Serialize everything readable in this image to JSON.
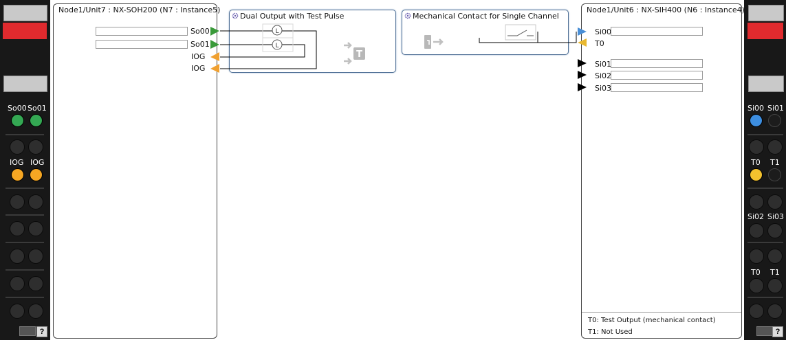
{
  "left_terminal": {
    "labels": [
      "So00",
      "So01",
      "IOG",
      "IOG"
    ],
    "led_colors": [
      "#34a853",
      "#34a853",
      "#f5a623",
      "#f5a623"
    ],
    "help": "?"
  },
  "right_terminal": {
    "labels": [
      "Si00",
      "Si01",
      "T0",
      "T1",
      "Si02",
      "Si03",
      "T0",
      "T1"
    ],
    "led_colors": [
      "#3d8ee0",
      "#1c1c1c",
      "#f2c12e",
      "#1c1c1c"
    ],
    "help": "?"
  },
  "output_unit": {
    "title": "Node1/Unit7 : NX-SOH200 (N7 : Instance5)",
    "pins": [
      "So00",
      "So01",
      "IOG",
      "IOG"
    ]
  },
  "input_unit": {
    "title": "Node1/Unit6 : NX-SIH400 (N6 : Instance4)",
    "pins": [
      "Si00",
      "T0",
      "Si01",
      "Si02",
      "Si03"
    ],
    "notes": [
      "T0: Test Output (mechanical contact)",
      "T1: Not Used"
    ]
  },
  "fb_dual_output": {
    "title": "Dual Output with Test Pulse"
  },
  "fb_mechanical_contact": {
    "title": "Mechanical Contact for Single Channel"
  },
  "colors": {
    "output_arrow": "#3a9a3a",
    "iog_arrow": "#f0a030",
    "si_arrow": "#4a8fd6",
    "t0_arrow": "#e8b830",
    "inactive_arrow": "#000000"
  }
}
